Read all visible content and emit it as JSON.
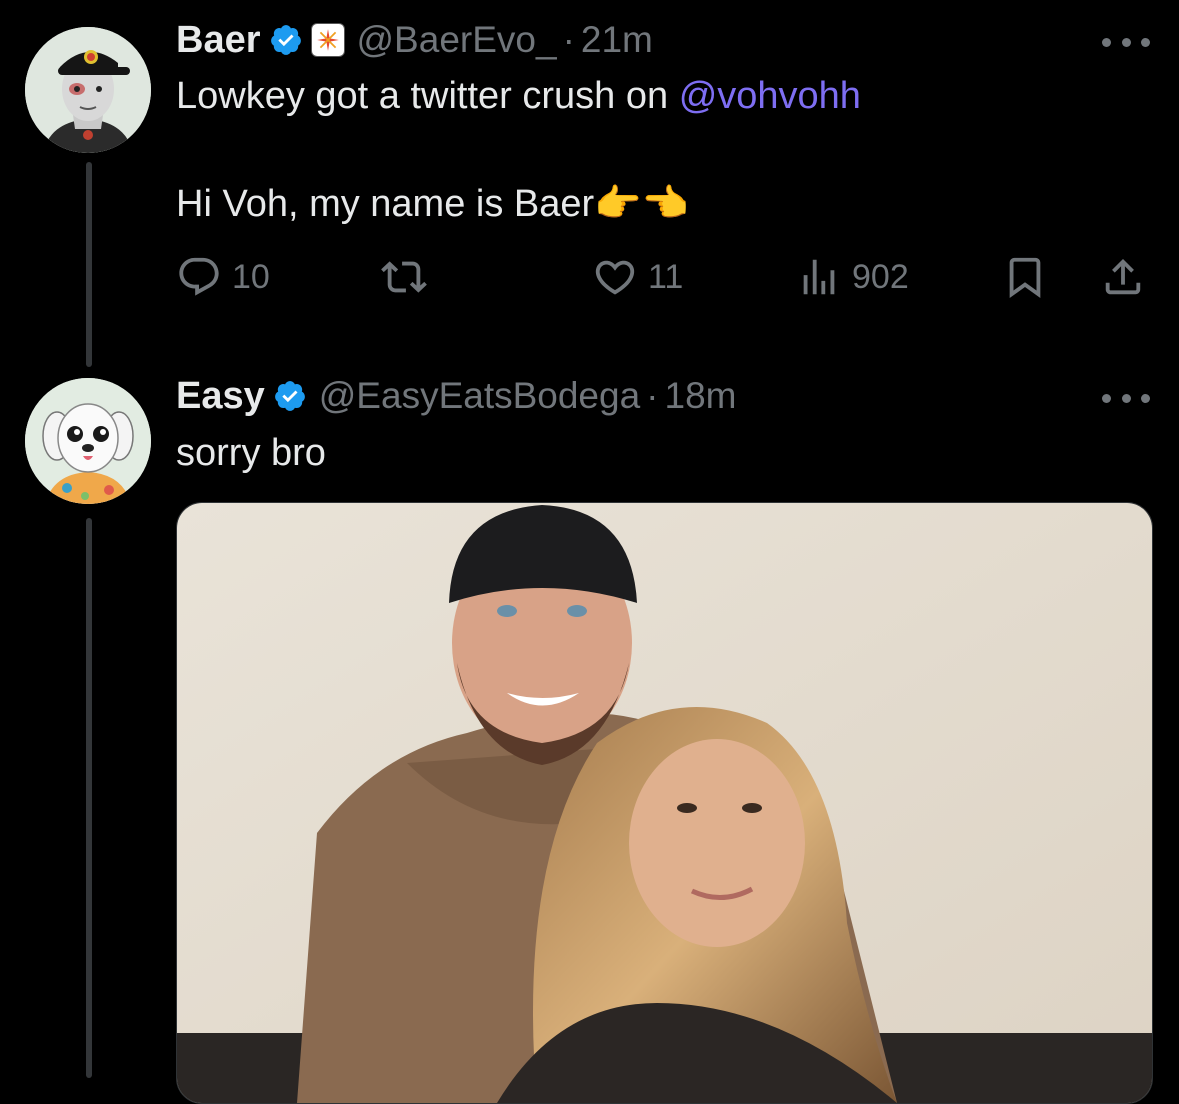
{
  "tweets": [
    {
      "name": "Baer",
      "handle": "@BaerEvo_",
      "separator": "·",
      "time": "21m",
      "text_line1": "Lowkey got a twitter crush on ",
      "mention": "@vohvohh",
      "text_line2": "Hi Voh, my name is Baer👉👈",
      "avatar_icon": "tattooed-cartoon-man-avatar",
      "stats": {
        "replies": "10",
        "retweets": "",
        "likes": "11",
        "views": "902"
      }
    },
    {
      "name": "Easy",
      "handle": "@EasyEatsBodega",
      "separator": "·",
      "time": "18m",
      "text": "sorry bro",
      "avatar_icon": "cartoon-white-dog-avatar",
      "media_icon": "couple-selfie-photo"
    }
  ],
  "colors": {
    "background": "#000000",
    "text": "#e7e9ea",
    "secondary": "#71767b",
    "mention": "#7e6ef2",
    "verified": "#1d9bf0"
  }
}
